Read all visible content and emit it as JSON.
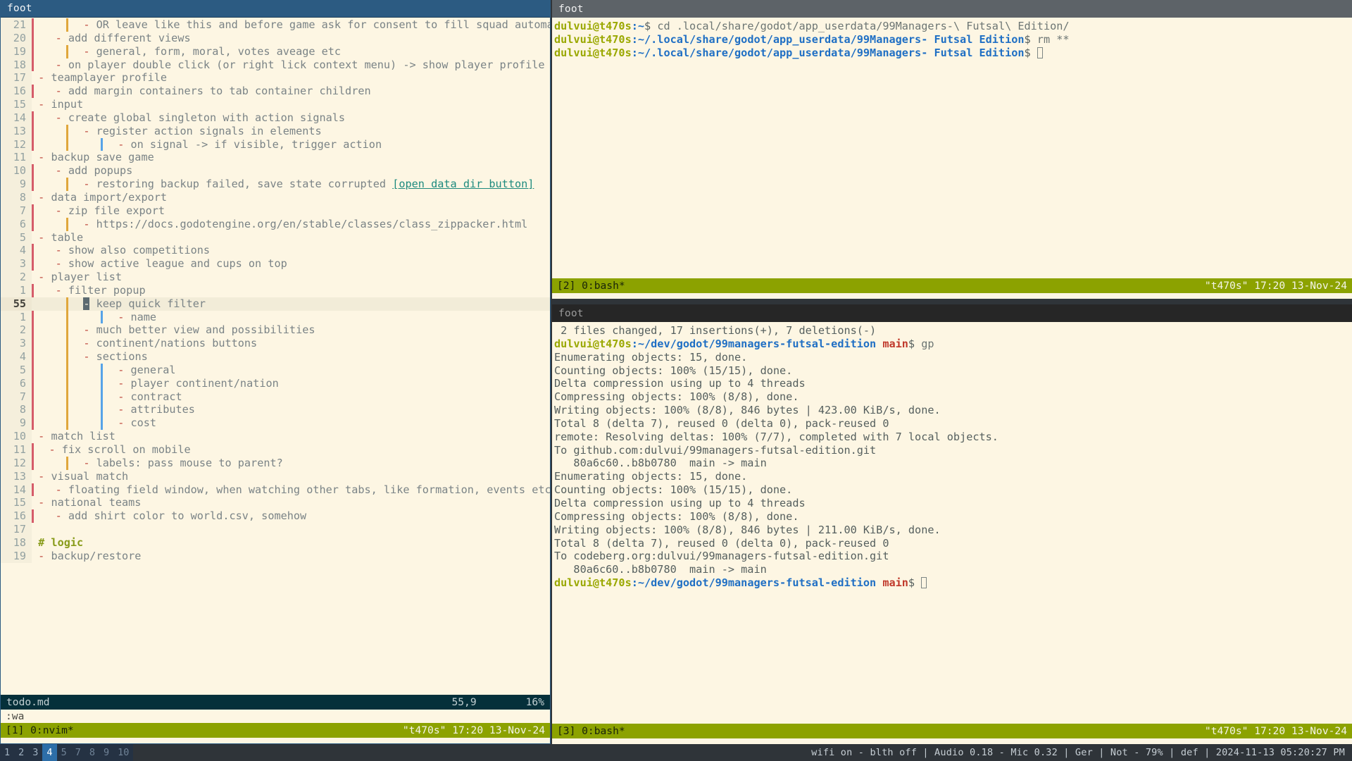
{
  "windows": {
    "nvim": {
      "title": "foot"
    },
    "term_top": {
      "title": "foot"
    },
    "term_bottom": {
      "title": "foot"
    }
  },
  "editor": {
    "filename": "todo.md",
    "position": "55,9",
    "percent": "16%",
    "command_line": ":wa",
    "tmux": {
      "left": "[1] 0:nvim*",
      "right": "\"t470s\" 17:20 13-Nov-24"
    },
    "lines": [
      {
        "num": "21",
        "guides": [
          "g1",
          "gsp",
          "g2"
        ],
        "indent": 7,
        "dash": "-",
        "text": " OR leave like this and before game ask for consent to fill squad automatically"
      },
      {
        "num": "20",
        "guides": [
          "g1"
        ],
        "indent": 4,
        "dash": "-",
        "text": " add different views"
      },
      {
        "num": "19",
        "guides": [
          "g1",
          "gsp",
          "g2"
        ],
        "indent": 7,
        "dash": "-",
        "text": " general, form, moral, votes aveage etc"
      },
      {
        "num": "18",
        "guides": [
          "g1"
        ],
        "indent": 4,
        "dash": "-",
        "text": " on player double click (or right lick context menu) -> show player profile"
      },
      {
        "num": "17",
        "guides": [],
        "indent": 1,
        "dash": "-",
        "text": " teamplayer profile"
      },
      {
        "num": "16",
        "guides": [
          "g1"
        ],
        "indent": 4,
        "dash": "-",
        "text": " add margin containers to tab container children"
      },
      {
        "num": "15",
        "guides": [],
        "indent": 1,
        "dash": "-",
        "text": " input"
      },
      {
        "num": "14",
        "guides": [
          "g1"
        ],
        "indent": 4,
        "dash": "-",
        "text": " create global singleton with action signals"
      },
      {
        "num": "13",
        "guides": [
          "g1",
          "gsp",
          "g2"
        ],
        "indent": 7,
        "dash": "-",
        "text": " register action signals in elements"
      },
      {
        "num": "12",
        "guides": [
          "g1",
          "gsp",
          "g2",
          "gsp",
          "g3"
        ],
        "indent": 10,
        "dash": "-",
        "text": " on signal -> if visible, trigger action"
      },
      {
        "num": "11",
        "guides": [],
        "indent": 1,
        "dash": "-",
        "text": " backup save game"
      },
      {
        "num": "10",
        "guides": [
          "g1"
        ],
        "indent": 4,
        "dash": "-",
        "text": " add popups"
      },
      {
        "num": "9",
        "guides": [
          "g1",
          "gsp",
          "g2"
        ],
        "indent": 7,
        "dash": "-",
        "text": " restoring backup failed, save state corrupted ",
        "link": "[open data dir button]"
      },
      {
        "num": "8",
        "guides": [],
        "indent": 1,
        "dash": "-",
        "text": " data import/export"
      },
      {
        "num": "7",
        "guides": [
          "g1"
        ],
        "indent": 4,
        "dash": "-",
        "text": " zip file export"
      },
      {
        "num": "6",
        "guides": [
          "g1",
          "gsp",
          "g2"
        ],
        "indent": 7,
        "dash": "-",
        "text": " https://docs.godotengine.org/en/stable/classes/class_zippacker.html"
      },
      {
        "num": "5",
        "guides": [],
        "indent": 1,
        "dash": "-",
        "text": " table"
      },
      {
        "num": "4",
        "guides": [
          "g1"
        ],
        "indent": 4,
        "dash": "-",
        "text": " show also competitions"
      },
      {
        "num": "3",
        "guides": [
          "g1"
        ],
        "indent": 4,
        "dash": "-",
        "text": " show active league and cups on top"
      },
      {
        "num": "2",
        "guides": [],
        "indent": 1,
        "dash": "-",
        "text": " player list"
      },
      {
        "num": "1",
        "guides": [
          "g1"
        ],
        "indent": 4,
        "dash": "-",
        "text": " filter popup"
      },
      {
        "num": "55",
        "guides": [
          "gsp",
          "gsp",
          "g2"
        ],
        "indent": 7,
        "dash": "-",
        "text": " keep quick filter",
        "cursor": true
      },
      {
        "num": "1",
        "guides": [
          "g1",
          "gsp",
          "g2",
          "gsp",
          "g3"
        ],
        "indent": 10,
        "dash": "-",
        "text": " name"
      },
      {
        "num": "2",
        "guides": [
          "g1",
          "gsp",
          "g2"
        ],
        "indent": 6,
        "dash": "-",
        "text": " much better view and possibilities"
      },
      {
        "num": "3",
        "guides": [
          "g1",
          "gsp",
          "g2"
        ],
        "indent": 6,
        "dash": "-",
        "text": " continent/nations buttons"
      },
      {
        "num": "4",
        "guides": [
          "g1",
          "gsp",
          "g2"
        ],
        "indent": 6,
        "dash": "-",
        "text": " sections"
      },
      {
        "num": "5",
        "guides": [
          "g1",
          "gsp",
          "g2",
          "gsp",
          "g3"
        ],
        "indent": 10,
        "dash": "-",
        "text": " general"
      },
      {
        "num": "6",
        "guides": [
          "g1",
          "gsp",
          "g2",
          "gsp",
          "g3"
        ],
        "indent": 10,
        "dash": "-",
        "text": " player continent/nation"
      },
      {
        "num": "7",
        "guides": [
          "g1",
          "gsp",
          "g2",
          "gsp",
          "g3"
        ],
        "indent": 10,
        "dash": "-",
        "text": " contract"
      },
      {
        "num": "8",
        "guides": [
          "g1",
          "gsp",
          "g2",
          "gsp",
          "g3"
        ],
        "indent": 10,
        "dash": "-",
        "text": " attributes"
      },
      {
        "num": "9",
        "guides": [
          "g1",
          "gsp",
          "g2",
          "gsp",
          "g3"
        ],
        "indent": 10,
        "dash": "-",
        "text": " cost"
      },
      {
        "num": "10",
        "guides": [],
        "indent": 1,
        "dash": "-",
        "text": " match list"
      },
      {
        "num": "11",
        "guides": [
          "g1"
        ],
        "indent": 2,
        "dash": "-",
        "text": " fix scroll on mobile"
      },
      {
        "num": "12",
        "guides": [
          "g1",
          "gsp",
          "g2"
        ],
        "indent": 4,
        "dash": "-",
        "text": " labels: pass mouse to parent?"
      },
      {
        "num": "13",
        "guides": [],
        "indent": 1,
        "dash": "-",
        "text": " visual match"
      },
      {
        "num": "14",
        "guides": [
          "g1"
        ],
        "indent": 4,
        "dash": "-",
        "text": " floating field window, when watching other tabs, like formation, events etc"
      },
      {
        "num": "15",
        "guides": [],
        "indent": 1,
        "dash": "-",
        "text": " national teams"
      },
      {
        "num": "16",
        "guides": [
          "g1"
        ],
        "indent": 4,
        "dash": "-",
        "text": " add shirt color to world.csv, somehow"
      },
      {
        "num": "17",
        "guides": [],
        "indent": 0,
        "dash": "",
        "text": ""
      },
      {
        "num": "18",
        "guides": [],
        "indent": 0,
        "dash": "",
        "heading": "# logic"
      },
      {
        "num": "19",
        "guides": [],
        "indent": 1,
        "dash": "-",
        "text": " backup/restore"
      }
    ]
  },
  "terminal_top": {
    "tmux": {
      "left": "[2] 0:bash*",
      "right": "\"t470s\" 17:20 13-Nov-24"
    },
    "rows": [
      {
        "user": "dulvui@t470s",
        "path": ":~",
        "sym": "$",
        "cmd": " cd .local/share/godot/app_userdata/99Managers-\\ Futsal\\ Edition/"
      },
      {
        "user": "dulvui@t470s",
        "path": ":~/.local/share/godot/app_userdata/99Managers- Futsal Edition",
        "sym": "$",
        "cmd": " rm **"
      },
      {
        "user": "dulvui@t470s",
        "path": ":~/.local/share/godot/app_userdata/99Managers- Futsal Edition",
        "sym": "$",
        "cmd": " ",
        "cursor": "hollow"
      }
    ]
  },
  "terminal_bottom": {
    "tmux": {
      "left": "[3] 0:bash*",
      "right": "\"t470s\" 17:20 13-Nov-24"
    },
    "rows": [
      {
        "plain": " 2 files changed, 17 insertions(+), 7 deletions(-)"
      },
      {
        "user": "dulvui@t470s",
        "path": ":~/dev/godot/99managers-futsal-edition",
        "branch": " main",
        "sym": "$",
        "cmd": " gp"
      },
      {
        "plain": "Enumerating objects: 15, done."
      },
      {
        "plain": "Counting objects: 100% (15/15), done."
      },
      {
        "plain": "Delta compression using up to 4 threads"
      },
      {
        "plain": "Compressing objects: 100% (8/8), done."
      },
      {
        "plain": "Writing objects: 100% (8/8), 846 bytes | 423.00 KiB/s, done."
      },
      {
        "plain": "Total 8 (delta 7), reused 0 (delta 0), pack-reused 0"
      },
      {
        "plain": "remote: Resolving deltas: 100% (7/7), completed with 7 local objects."
      },
      {
        "plain": "To github.com:dulvui/99managers-futsal-edition.git"
      },
      {
        "plain": "   80a6c60..b8b0780  main -> main"
      },
      {
        "plain": "Enumerating objects: 15, done."
      },
      {
        "plain": "Counting objects: 100% (15/15), done."
      },
      {
        "plain": "Delta compression using up to 4 threads"
      },
      {
        "plain": "Compressing objects: 100% (8/8), done."
      },
      {
        "plain": "Writing objects: 100% (8/8), 846 bytes | 211.00 KiB/s, done."
      },
      {
        "plain": "Total 8 (delta 7), reused 0 (delta 0), pack-reused 0"
      },
      {
        "plain": "To codeberg.org:dulvui/99managers-futsal-edition.git"
      },
      {
        "plain": "   80a6c60..b8b0780  main -> main"
      },
      {
        "user": "dulvui@t470s",
        "path": ":~/dev/godot/99managers-futsal-edition",
        "branch": " main",
        "sym": "$",
        "cmd": " ",
        "cursor": "hollow"
      }
    ]
  },
  "taskbar": {
    "workspaces": [
      {
        "label": "1",
        "state": "used"
      },
      {
        "label": "2",
        "state": "used"
      },
      {
        "label": "3",
        "state": "used"
      },
      {
        "label": "4",
        "state": "active"
      },
      {
        "label": "5",
        "state": "dim"
      },
      {
        "label": "7",
        "state": "dim"
      },
      {
        "label": "8",
        "state": "dim"
      },
      {
        "label": "9",
        "state": "dim"
      },
      {
        "label": "10",
        "state": "dim"
      }
    ],
    "status": "wifi on - blth off | Audio 0.18 - Mic 0.32 | Ger | Not - 79% | def | 2024-11-13 05:20:27 PM"
  }
}
